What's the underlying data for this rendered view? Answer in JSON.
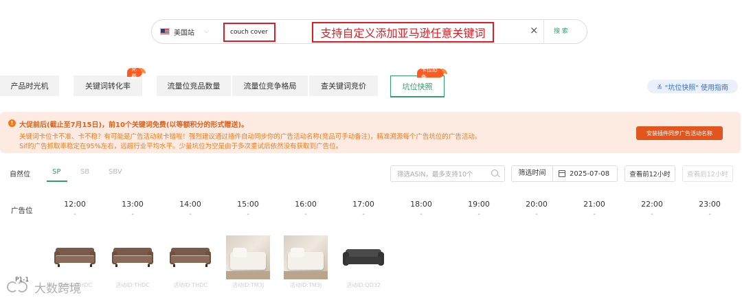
{
  "search": {
    "site_label": "美国站",
    "keyword": "couch cover",
    "callout": "支持自定义添加亚马逊任意关键词",
    "clear_symbol": "×",
    "search_label": "搜 索"
  },
  "tabs": [
    {
      "label": "产品时光机"
    },
    {
      "label": "关键词转化率",
      "badge": "免费"
    },
    {
      "label": "流量位竞品数量"
    },
    {
      "label": "流量位竞争格局"
    },
    {
      "label": "查关键词竞价"
    },
    {
      "label": "坑位快照",
      "badge": "卡位必备",
      "active": true
    }
  ],
  "guide_link": "≚ \"坑位快照\" 使用指南",
  "notice": {
    "line1": "大促前后(截止至7月15日)，前10个关键词免费(以等额积分的形式赠送)。",
    "line2": "关键词卡位卡不准、卡不稳？有可能是广告活动就卡错啦！强烈建议通过插件自动同步你的广告活动名称(竞品可手动备注)，精准溯源每个广告坑位的广告活动。",
    "line3": "Sif的广告抓取率稳定在95%左右，远超行业平均水平。少量坑位为空是由于多次重试后依然没有获取到广告位。",
    "button": "安装插件同步广告活动名称"
  },
  "filters": {
    "tabs": [
      "自然位",
      "SP",
      "SB",
      "SBV"
    ],
    "asin_placeholder": "筛选ASIN，最多支持10个",
    "date_label": "筛选时间",
    "date_value": "2025-07-08",
    "prev_12h": "查看前12小时",
    "next_12h": "查看后12小时"
  },
  "timeline": {
    "row_header": "广告位",
    "hours": [
      "12:00",
      "13:00",
      "14:00",
      "15:00",
      "16:00",
      "17:00",
      "18:00",
      "19:00",
      "20:00",
      "21:00",
      "22:00",
      "23:00"
    ],
    "dash": "-"
  },
  "products": [
    {
      "label": "活动ID:THDC",
      "image": "sofa-brown"
    },
    {
      "label": "活动ID:THDC",
      "image": "sofa-brown"
    },
    {
      "label": "活动ID:THDC",
      "image": "sofa-brown"
    },
    {
      "label": "活动ID:TM3J",
      "image": "photo-beige"
    },
    {
      "label": "活动ID:TM3J",
      "image": "photo-beige"
    },
    {
      "label": "活动ID:QD32",
      "image": "sofa-gray"
    }
  ],
  "slot_label": "P1-1",
  "watermark": "大数跨境",
  "colors": {
    "accent": "#2e9e6b",
    "alert": "#e01b22",
    "warning": "#f07a1a"
  }
}
